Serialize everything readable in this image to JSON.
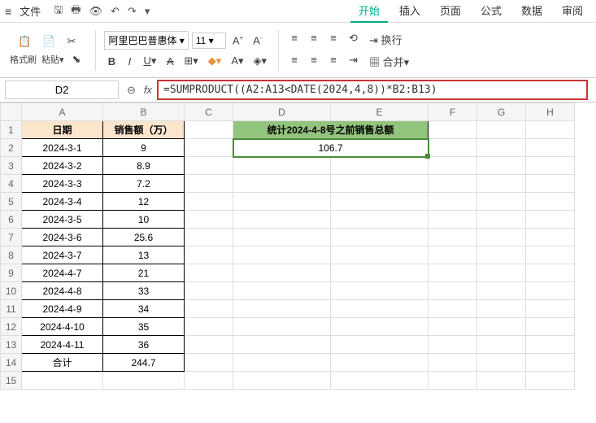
{
  "titlebar": {
    "file_label": "文件"
  },
  "tabs": {
    "start": "开始",
    "insert": "插入",
    "page": "页面",
    "formula": "公式",
    "data": "数据",
    "review": "审阅"
  },
  "ribbon": {
    "format_painter": "格式刷",
    "paste": "粘贴",
    "font_name": "阿里巴巴普惠体",
    "font_size": "11",
    "wrap": "换行",
    "merge": "合并"
  },
  "namebox": "D2",
  "formula": "=SUMPRODUCT((A2:A13<DATE(2024,4,8))*B2:B13)",
  "columns": [
    "A",
    "B",
    "C",
    "D",
    "E",
    "F",
    "G",
    "H"
  ],
  "headers": {
    "a": "日期",
    "b": "销售额（万）"
  },
  "green_title": "统计2024-4-8号之前销售总额",
  "green_value": "106.7",
  "rows": [
    {
      "a": "2024-3-1",
      "b": "9"
    },
    {
      "a": "2024-3-2",
      "b": "8.9"
    },
    {
      "a": "2024-3-3",
      "b": "7.2"
    },
    {
      "a": "2024-3-4",
      "b": "12"
    },
    {
      "a": "2024-3-5",
      "b": "10"
    },
    {
      "a": "2024-3-6",
      "b": "25.6"
    },
    {
      "a": "2024-3-7",
      "b": "13"
    },
    {
      "a": "2024-4-7",
      "b": "21"
    },
    {
      "a": "2024-4-8",
      "b": "33"
    },
    {
      "a": "2024-4-9",
      "b": "34"
    },
    {
      "a": "2024-4-10",
      "b": "35"
    },
    {
      "a": "2024-4-11",
      "b": "36"
    },
    {
      "a": "合计",
      "b": "244.7"
    }
  ]
}
